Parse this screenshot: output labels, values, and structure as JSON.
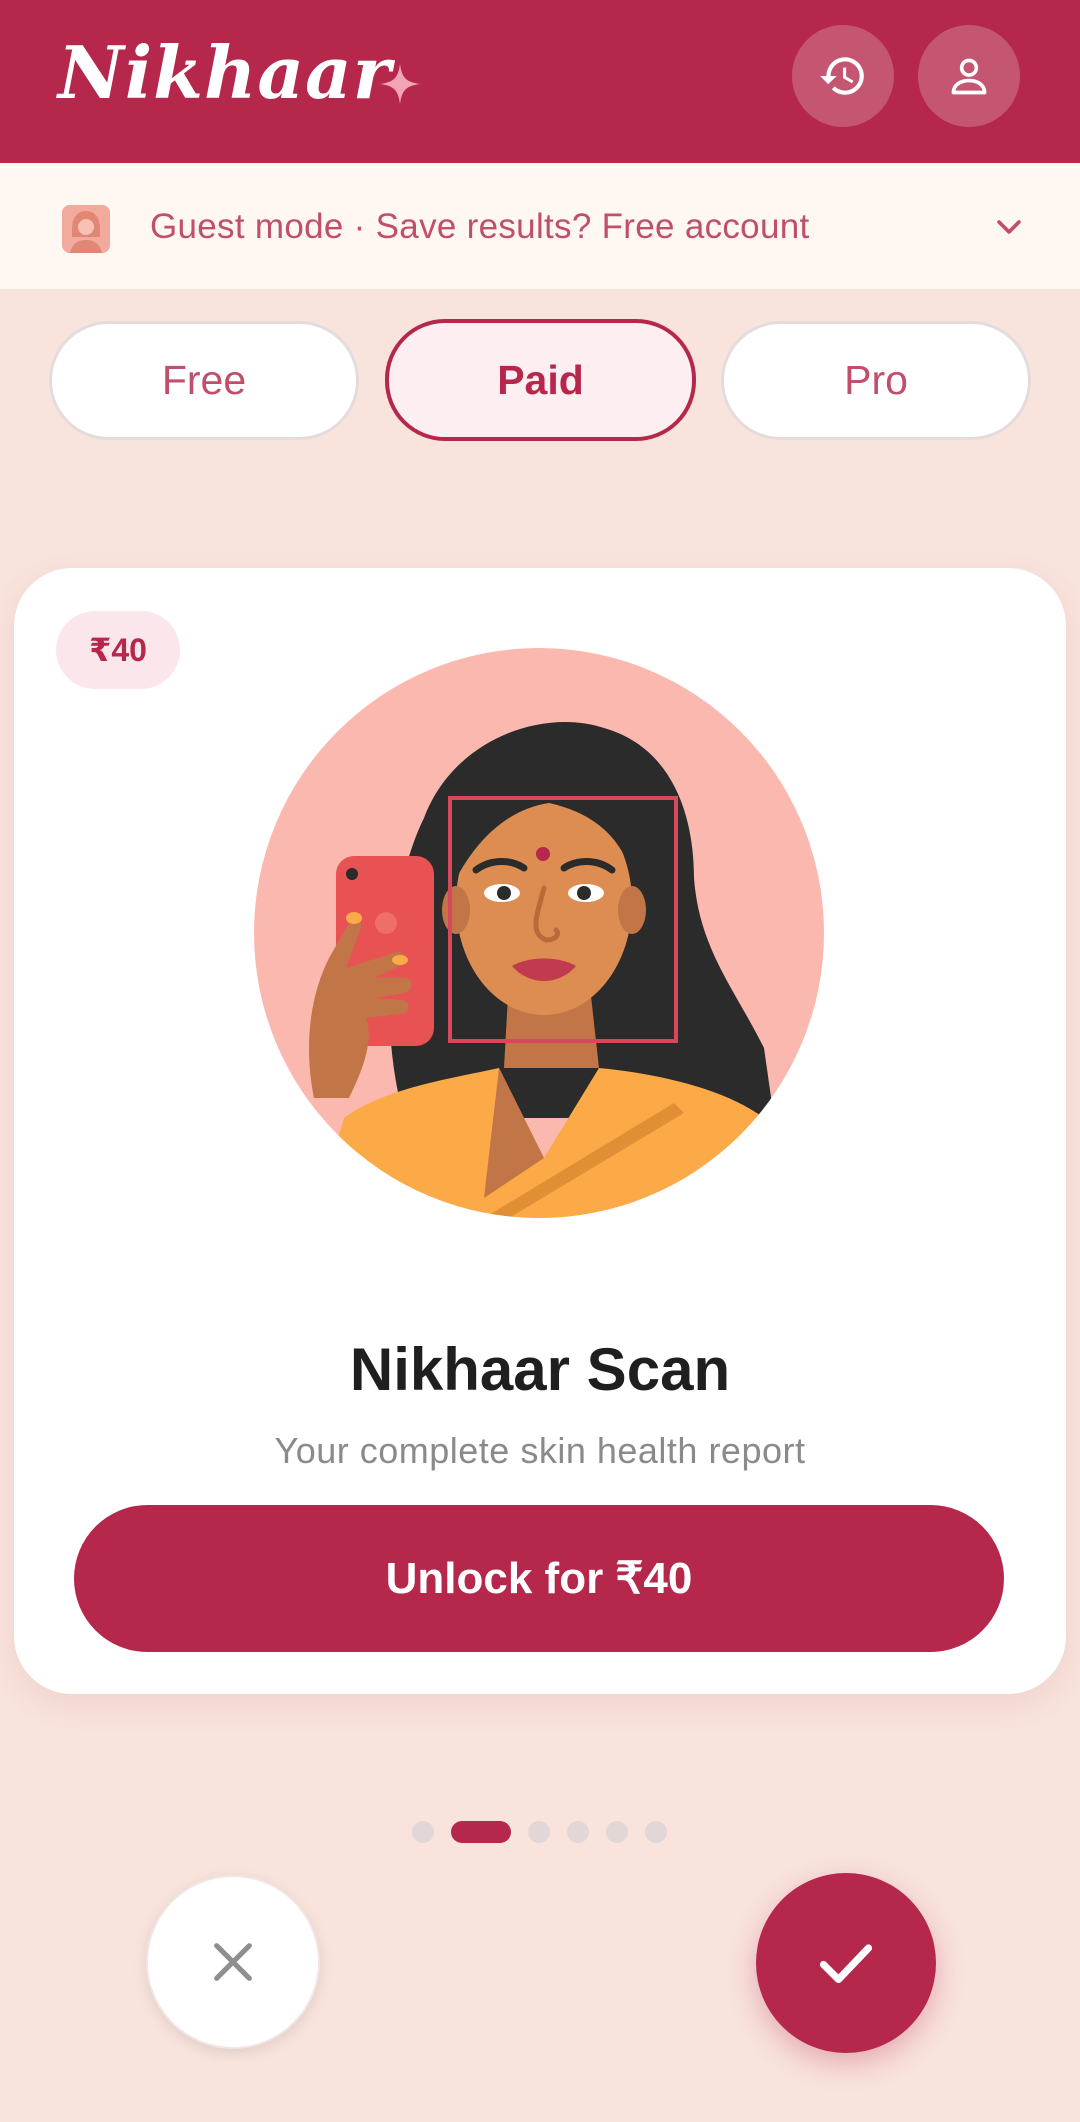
{
  "app": {
    "brand": "Nikhaar",
    "colors": {
      "primary": "#b5274b",
      "background": "#f9e3dd",
      "banner": "#fff7f2",
      "text_muted": "#8a8a8a"
    },
    "icons": {
      "history": "history-icon",
      "profile": "user-icon",
      "sparkle": "sparkle-icon"
    }
  },
  "guest_banner": {
    "text": "Guest mode · Save results? Free account",
    "icon": "chevron-down-icon"
  },
  "tiers": [
    {
      "label": "Free",
      "selected": false
    },
    {
      "label": "Paid",
      "selected": true
    },
    {
      "label": "Pro",
      "selected": false
    }
  ],
  "card": {
    "price_badge": "₹40",
    "title": "Nikhaar Scan",
    "subtitle": "Your complete skin health report",
    "cta": "Unlock for ₹40",
    "illustration": "woman-taking-selfie-face-scan"
  },
  "pager": {
    "total": 6,
    "active_index": 1
  },
  "actions": {
    "skip_icon": "close-icon",
    "accept_icon": "check-icon"
  }
}
